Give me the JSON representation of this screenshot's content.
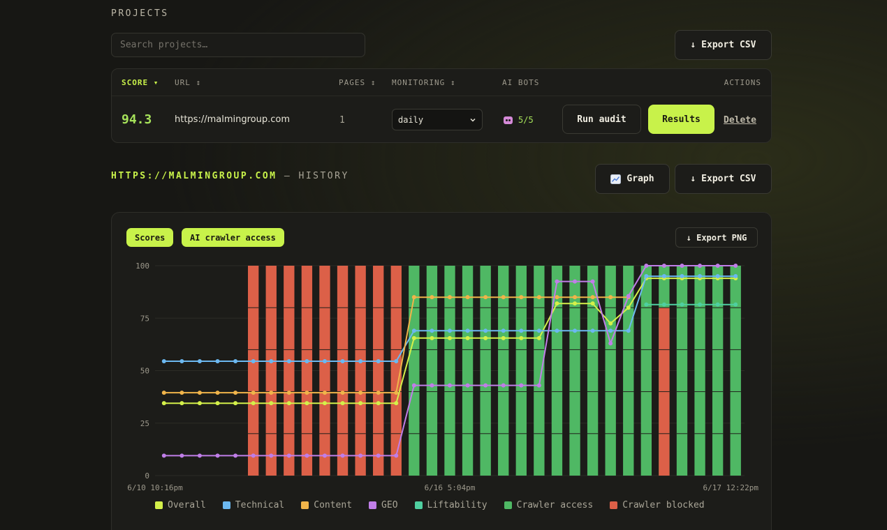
{
  "projects": {
    "title": "PROJECTS",
    "search_placeholder": "Search projects…",
    "export_label": "↓ Export CSV",
    "columns": {
      "score": "SCORE ▾",
      "url": "URL ↕",
      "pages": "PAGES ↕",
      "monitoring": "MONITORING ↕",
      "ai_bots": "AI BOTS",
      "actions": "ACTIONS"
    },
    "row": {
      "score": "94.3",
      "url": "https://malmingroup.com",
      "pages": "1",
      "monitoring": "daily",
      "ai_bots": "5/5",
      "run_audit": "Run audit",
      "results": "Results",
      "delete": "Delete"
    }
  },
  "history": {
    "title_url": "HTTPS://MALMINGROUP.COM",
    "title_rest": " — HISTORY",
    "graph_label": "Graph",
    "export_csv_label": "↓ Export CSV",
    "tabs": [
      "Scores",
      "AI crawler access"
    ],
    "export_png_label": "↓ Export PNG"
  },
  "colors": {
    "accent": "#c8f24a",
    "overall": "#d4f04a",
    "technical": "#6cb8f0",
    "content": "#f0b44a",
    "geo": "#c07ee8",
    "liftability": "#4fcfa0",
    "access": "#4fb864",
    "blocked": "#dc6048"
  },
  "legend": [
    {
      "label": "Overall",
      "color": "#d4f04a"
    },
    {
      "label": "Technical",
      "color": "#6cb8f0"
    },
    {
      "label": "Content",
      "color": "#f0b44a"
    },
    {
      "label": "GEO",
      "color": "#c07ee8"
    },
    {
      "label": "Liftability",
      "color": "#4fcfa0"
    },
    {
      "label": "Crawler access",
      "color": "#4fb864"
    },
    {
      "label": "Crawler blocked",
      "color": "#dc6048"
    }
  ],
  "chart_data": {
    "type": "line",
    "ylim": [
      0,
      100
    ],
    "yticks": [
      0,
      25,
      50,
      75,
      100
    ],
    "xtick_labels": [
      "6/10 10:16pm",
      "6/16 5:04pm",
      "6/17 12:22pm"
    ],
    "grid": true,
    "legend_position": "bottom",
    "series": [
      {
        "name": "Overall",
        "values": [
          34.5,
          34.5,
          34.5,
          34.5,
          34.5,
          34.5,
          34.5,
          34.5,
          34.5,
          34.5,
          34.5,
          34.5,
          34.5,
          34.5,
          65.5,
          65.5,
          65.5,
          65.5,
          65.5,
          65.5,
          65.5,
          65.5,
          82,
          82,
          82,
          72.5,
          80,
          94,
          94,
          94,
          94,
          94,
          94
        ]
      },
      {
        "name": "Technical",
        "values": [
          54.5,
          54.5,
          54.5,
          54.5,
          54.5,
          54.5,
          54.5,
          54.5,
          54.5,
          54.5,
          54.5,
          54.5,
          54.5,
          54.5,
          69,
          69,
          69,
          69,
          69,
          69,
          69,
          69,
          69,
          69,
          69,
          69,
          69,
          95,
          95,
          95,
          95,
          95,
          95
        ]
      },
      {
        "name": "Content",
        "values": [
          39.5,
          39.5,
          39.5,
          39.5,
          39.5,
          39.5,
          39.5,
          39.5,
          39.5,
          39.5,
          39.5,
          39.5,
          39.5,
          39.5,
          85,
          85,
          85,
          85,
          85,
          85,
          85,
          85,
          85,
          85,
          85,
          85,
          85,
          null,
          null,
          null,
          null,
          null,
          null
        ]
      },
      {
        "name": "GEO",
        "values": [
          9.5,
          9.5,
          9.5,
          9.5,
          9.5,
          9.5,
          9.5,
          9.5,
          9.5,
          9.5,
          9.5,
          9.5,
          9.5,
          9.5,
          43,
          43,
          43,
          43,
          43,
          43,
          43,
          43,
          92.5,
          92.5,
          92.5,
          63,
          85.5,
          100,
          100,
          100,
          100,
          100,
          100
        ]
      },
      {
        "name": "Liftability",
        "values": [
          null,
          null,
          null,
          null,
          null,
          null,
          null,
          null,
          null,
          null,
          null,
          null,
          null,
          null,
          null,
          null,
          null,
          null,
          null,
          null,
          null,
          null,
          null,
          null,
          null,
          null,
          null,
          81.5,
          81.5,
          81.5,
          81.5,
          81.5,
          81.5
        ]
      }
    ],
    "access_bars": {
      "first_index": 5,
      "count": 28,
      "blocked_fraction": [
        1,
        1,
        1,
        1,
        1,
        1,
        1,
        1,
        1,
        0,
        0,
        0,
        0,
        0,
        0,
        0,
        0,
        0,
        0,
        0,
        0,
        0,
        0,
        0.8,
        0,
        0,
        0,
        0
      ]
    }
  }
}
